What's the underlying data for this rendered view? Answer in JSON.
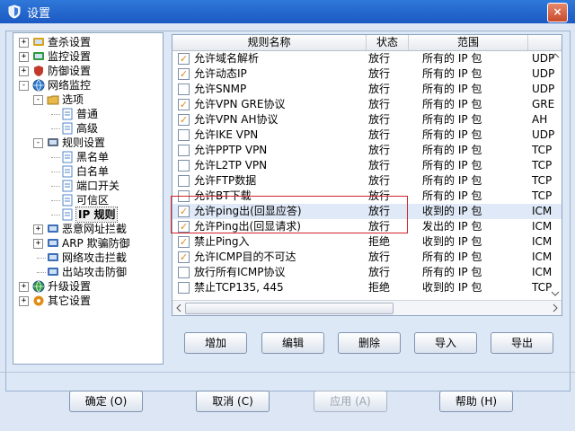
{
  "window": {
    "title": "设置",
    "close_glyph": "×"
  },
  "tree": [
    {
      "label": "查杀设置",
      "indent": 0,
      "expander": "+",
      "icon": "search-icon",
      "color": "#d9a21c"
    },
    {
      "label": "监控设置",
      "indent": 0,
      "expander": "+",
      "icon": "umbrella-icon",
      "color": "#2e9a3a"
    },
    {
      "label": "防御设置",
      "indent": 0,
      "expander": "+",
      "icon": "shield-icon",
      "color": "#c23a2c"
    },
    {
      "label": "网络监控",
      "indent": 0,
      "expander": "-",
      "icon": "globe-icon",
      "color": "#2c7bd0"
    },
    {
      "label": "选项",
      "indent": 1,
      "expander": "-",
      "icon": "folder-icon",
      "color": "#e8b84a"
    },
    {
      "label": "普通",
      "indent": 2,
      "expander": "",
      "icon": "page-icon",
      "color": "#4f86c8"
    },
    {
      "label": "高级",
      "indent": 2,
      "expander": "",
      "icon": "page-icon",
      "color": "#4f86c8"
    },
    {
      "label": "规则设置",
      "indent": 1,
      "expander": "-",
      "icon": "rules-icon",
      "color": "#5a6a80"
    },
    {
      "label": "黑名单",
      "indent": 2,
      "expander": "",
      "icon": "page-icon",
      "color": "#4f86c8"
    },
    {
      "label": "白名单",
      "indent": 2,
      "expander": "",
      "icon": "page-icon",
      "color": "#4f86c8"
    },
    {
      "label": "端口开关",
      "indent": 2,
      "expander": "",
      "icon": "page-icon",
      "color": "#4f86c8"
    },
    {
      "label": "可信区",
      "indent": 2,
      "expander": "",
      "icon": "page-icon",
      "color": "#4f86c8"
    },
    {
      "label": "IP 规则",
      "indent": 2,
      "expander": "",
      "icon": "page-icon",
      "color": "#4f86c8",
      "selected": true
    },
    {
      "label": "恶意网址拦截",
      "indent": 1,
      "expander": "+",
      "icon": "network-icon",
      "color": "#3d6fb8"
    },
    {
      "label": "ARP 欺骗防御",
      "indent": 1,
      "expander": "+",
      "icon": "arp-icon",
      "color": "#3d6fb8"
    },
    {
      "label": "网络攻击拦截",
      "indent": 1,
      "expander": "",
      "icon": "network-icon",
      "color": "#3d6fb8"
    },
    {
      "label": "出站攻击防御",
      "indent": 1,
      "expander": "",
      "icon": "computer-icon",
      "color": "#3d6fb8"
    },
    {
      "label": "升级设置",
      "indent": 0,
      "expander": "+",
      "icon": "upgrade-icon",
      "color": "#2e9a3a"
    },
    {
      "label": "其它设置",
      "indent": 0,
      "expander": "+",
      "icon": "gear-icon",
      "color": "#e08b16"
    }
  ],
  "table": {
    "columns": [
      "规则名称",
      "状态",
      "范围",
      ""
    ],
    "rows": [
      {
        "checked": true,
        "name": "允许域名解析",
        "status": "放行",
        "scope": "所有的 IP 包",
        "proto": "UDP"
      },
      {
        "checked": true,
        "name": "允许动态IP",
        "status": "放行",
        "scope": "所有的 IP 包",
        "proto": "UDP"
      },
      {
        "checked": false,
        "name": "允许SNMP",
        "status": "放行",
        "scope": "所有的 IP 包",
        "proto": "UDP"
      },
      {
        "checked": true,
        "name": "允许VPN GRE协议",
        "status": "放行",
        "scope": "所有的 IP 包",
        "proto": "GRE"
      },
      {
        "checked": true,
        "name": "允许VPN AH协议",
        "status": "放行",
        "scope": "所有的 IP 包",
        "proto": "AH"
      },
      {
        "checked": false,
        "name": "允许IKE VPN",
        "status": "放行",
        "scope": "所有的 IP 包",
        "proto": "UDP"
      },
      {
        "checked": false,
        "name": "允许PPTP VPN",
        "status": "放行",
        "scope": "所有的 IP 包",
        "proto": "TCP"
      },
      {
        "checked": false,
        "name": "允许L2TP VPN",
        "status": "放行",
        "scope": "所有的 IP 包",
        "proto": "TCP"
      },
      {
        "checked": false,
        "name": "允许FTP数据",
        "status": "放行",
        "scope": "所有的 IP 包",
        "proto": "TCP"
      },
      {
        "checked": false,
        "name": "允许BT下载",
        "status": "放行",
        "scope": "所有的 IP 包",
        "proto": "TCP"
      },
      {
        "checked": true,
        "name": "允许ping出(回显应答)",
        "status": "放行",
        "scope": "收到的 IP 包",
        "proto": "ICM",
        "highlight": true
      },
      {
        "checked": true,
        "name": "允许Ping出(回显请求)",
        "status": "放行",
        "scope": "发出的 IP 包",
        "proto": "ICM"
      },
      {
        "checked": true,
        "name": "禁止Ping入",
        "status": "拒绝",
        "scope": "收到的 IP 包",
        "proto": "ICM"
      },
      {
        "checked": true,
        "name": "允许ICMP目的不可达",
        "status": "放行",
        "scope": "所有的 IP 包",
        "proto": "ICM"
      },
      {
        "checked": false,
        "name": "放行所有ICMP协议",
        "status": "放行",
        "scope": "所有的 IP 包",
        "proto": "ICM"
      },
      {
        "checked": false,
        "name": "禁止TCP135, 445",
        "status": "拒绝",
        "scope": "收到的 IP 包",
        "proto": "TCP"
      }
    ]
  },
  "list_buttons": {
    "add": "增加",
    "edit": "编辑",
    "delete": "删除",
    "import": "导入",
    "export": "导出"
  },
  "footer_buttons": {
    "ok": "确定 (O)",
    "cancel": "取消 (C)",
    "apply": "应用 (A)",
    "help": "帮助 (H)"
  },
  "colors": {
    "title_bar": "#1b59c2",
    "highlight_box": "#d2232a",
    "check_mark": "#e08b16"
  }
}
